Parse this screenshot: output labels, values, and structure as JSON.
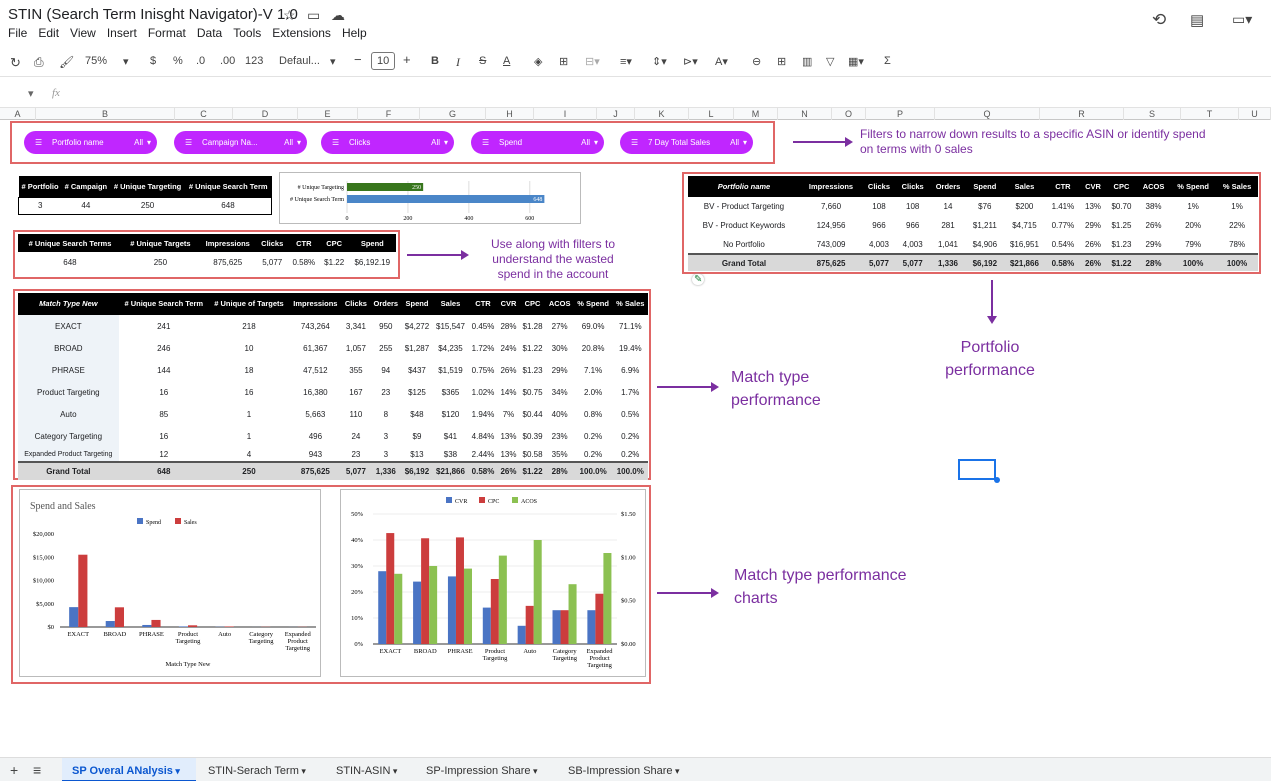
{
  "doc": {
    "title": "STIN (Search Term Inisght Navigator)-V 1.0"
  },
  "menu": [
    "File",
    "Edit",
    "View",
    "Insert",
    "Format",
    "Data",
    "Tools",
    "Extensions",
    "Help"
  ],
  "toolbar": {
    "zoom": "75%",
    "currency": "$",
    "percent": "%",
    "dec_less": ".0",
    "dec_more": ".00",
    "num": "123",
    "font": "Defaul...",
    "size": "10"
  },
  "formula_bar": {
    "cell_ref": "",
    "fx": "fx"
  },
  "columns": [
    "A",
    "B",
    "C",
    "D",
    "E",
    "F",
    "G",
    "H",
    "I",
    "J",
    "K",
    "L",
    "M",
    "N",
    "O",
    "P",
    "Q",
    "R",
    "S",
    "T",
    "U"
  ],
  "filters": [
    {
      "label": "Portfolio name",
      "value": "All"
    },
    {
      "label": "Campaign Na...",
      "value": "All"
    },
    {
      "label": "Clicks",
      "value": "All"
    },
    {
      "label": "Spend",
      "value": "All"
    },
    {
      "label": "7 Day Total Sales",
      "value": "All"
    }
  ],
  "notes": {
    "filters": "Filters to narrow down results to a specific ASIN or identify spend on terms with 0 sales",
    "wasted": "Use along with filters to understand the wasted spend in the account",
    "match": "Match type performance",
    "portfolio": "Portfolio performance",
    "charts": "Match type performance charts"
  },
  "summary": {
    "headers": [
      "# Portfolio",
      "# Campaign",
      "# Unique Targeting",
      "# Unique Search Term"
    ],
    "values": [
      "3",
      "44",
      "250",
      "648"
    ]
  },
  "mini_chart": {
    "labels": [
      "# Unique Targeting",
      "# Unique Search Term"
    ],
    "values": [
      250,
      648
    ],
    "ticks": [
      "0",
      "200",
      "400",
      "600"
    ],
    "colors": [
      "#38761d",
      "#4a86c8"
    ]
  },
  "kpi": {
    "headers": [
      "# Unique Search Terms",
      "# Unique Targets",
      "Impressions",
      "Clicks",
      "CTR",
      "CPC",
      "Spend"
    ],
    "values": [
      "648",
      "250",
      "875,625",
      "5,077",
      "0.58%",
      "$1.22",
      "$6,192.19"
    ]
  },
  "match": {
    "headers": [
      "Match Type New",
      "# Unique Search Term",
      "# Unique of Targets",
      "Impressions",
      "Clicks",
      "Orders",
      "Spend",
      "Sales",
      "CTR",
      "CVR",
      "CPC",
      "ACOS",
      "% Spend",
      "% Sales"
    ],
    "rows": [
      [
        "EXACT",
        "241",
        "218",
        "743,264",
        "3,341",
        "950",
        "$4,272",
        "$15,547",
        "0.45%",
        "28%",
        "$1.28",
        "27%",
        "69.0%",
        "71.1%"
      ],
      [
        "BROAD",
        "246",
        "10",
        "61,367",
        "1,057",
        "255",
        "$1,287",
        "$4,235",
        "1.72%",
        "24%",
        "$1.22",
        "30%",
        "20.8%",
        "19.4%"
      ],
      [
        "PHRASE",
        "144",
        "18",
        "47,512",
        "355",
        "94",
        "$437",
        "$1,519",
        "0.75%",
        "26%",
        "$1.23",
        "29%",
        "7.1%",
        "6.9%"
      ],
      [
        "Product Targeting",
        "16",
        "16",
        "16,380",
        "167",
        "23",
        "$125",
        "$365",
        "1.02%",
        "14%",
        "$0.75",
        "34%",
        "2.0%",
        "1.7%"
      ],
      [
        "Auto",
        "85",
        "1",
        "5,663",
        "110",
        "8",
        "$48",
        "$120",
        "1.94%",
        "7%",
        "$0.44",
        "40%",
        "0.8%",
        "0.5%"
      ],
      [
        "Category Targeting",
        "16",
        "1",
        "496",
        "24",
        "3",
        "$9",
        "$41",
        "4.84%",
        "13%",
        "$0.39",
        "23%",
        "0.2%",
        "0.2%"
      ],
      [
        "Expanded Product Targeting",
        "12",
        "4",
        "943",
        "23",
        "3",
        "$13",
        "$38",
        "2.44%",
        "13%",
        "$0.58",
        "35%",
        "0.2%",
        "0.2%"
      ]
    ],
    "total": [
      "Grand Total",
      "648",
      "250",
      "875,625",
      "5,077",
      "1,336",
      "$6,192",
      "$21,866",
      "0.58%",
      "26%",
      "$1.22",
      "28%",
      "100.0%",
      "100.0%"
    ]
  },
  "portfolio": {
    "headers": [
      "Portfolio name",
      "Impressions",
      "Clicks",
      "Clicks",
      "Orders",
      "Spend",
      "Sales",
      "CTR",
      "CVR",
      "CPC",
      "ACOS",
      "% Spend",
      "% Sales"
    ],
    "rows": [
      [
        "BV - Product Targeting",
        "7,660",
        "108",
        "108",
        "14",
        "$76",
        "$200",
        "1.41%",
        "13%",
        "$0.70",
        "38%",
        "1%",
        "1%"
      ],
      [
        "BV - Product Keywords",
        "124,956",
        "966",
        "966",
        "281",
        "$1,211",
        "$4,715",
        "0.77%",
        "29%",
        "$1.25",
        "26%",
        "20%",
        "22%"
      ],
      [
        "No Portfolio",
        "743,009",
        "4,003",
        "4,003",
        "1,041",
        "$4,906",
        "$16,951",
        "0.54%",
        "26%",
        "$1.23",
        "29%",
        "79%",
        "78%"
      ]
    ],
    "total": [
      "Grand Total",
      "875,625",
      "5,077",
      "5,077",
      "1,336",
      "$6,192",
      "$21,866",
      "0.58%",
      "26%",
      "$1.22",
      "28%",
      "100%",
      "100%"
    ]
  },
  "chart_data": [
    {
      "type": "bar",
      "title": "Spend and Sales",
      "xlabel": "Match Type New",
      "categories": [
        "EXACT",
        "BROAD",
        "PHRASE",
        "Product Targeting",
        "Auto",
        "Category Targeting",
        "Expanded Product Targeting"
      ],
      "series": [
        {
          "name": "Spend",
          "values": [
            4272,
            1287,
            437,
            125,
            48,
            9,
            13
          ],
          "color": "#4a74c4"
        },
        {
          "name": "Sales",
          "values": [
            15547,
            4235,
            1519,
            365,
            120,
            41,
            38
          ],
          "color": "#cc3d3d"
        }
      ],
      "ylim": [
        0,
        20000
      ],
      "yticks": [
        "$0",
        "$5,000",
        "$10,000",
        "$15,000",
        "$20,000"
      ],
      "legend": "top"
    },
    {
      "type": "bar",
      "categories": [
        "EXACT",
        "BROAD",
        "PHRASE",
        "Product Targeting",
        "Auto",
        "Category Targeting",
        "Expanded Product Targeting"
      ],
      "series": [
        {
          "name": "CVR",
          "values": [
            28,
            24,
            26,
            14,
            7,
            13,
            13
          ],
          "color": "#4a74c4",
          "axis": "left"
        },
        {
          "name": "CPC",
          "values": [
            1.28,
            1.22,
            1.23,
            0.75,
            0.44,
            0.39,
            0.58
          ],
          "color": "#cc3d3d",
          "axis": "right"
        },
        {
          "name": "ACOS",
          "values": [
            27,
            30,
            29,
            34,
            40,
            23,
            35
          ],
          "color": "#8cc152",
          "axis": "left"
        }
      ],
      "ylim": [
        0,
        50
      ],
      "yticks": [
        "0%",
        "10%",
        "20%",
        "30%",
        "40%",
        "50%"
      ],
      "y2lim": [
        0,
        1.5
      ],
      "y2ticks": [
        "$0.00",
        "$0.50",
        "$1.00",
        "$1.50"
      ],
      "legend": "top"
    }
  ],
  "sheets": [
    {
      "name": "SP Overal ANalysis",
      "active": true
    },
    {
      "name": "STIN-Serach Term"
    },
    {
      "name": "STIN-ASIN"
    },
    {
      "name": "SP-Impression Share"
    },
    {
      "name": "SB-Impression Share"
    }
  ]
}
